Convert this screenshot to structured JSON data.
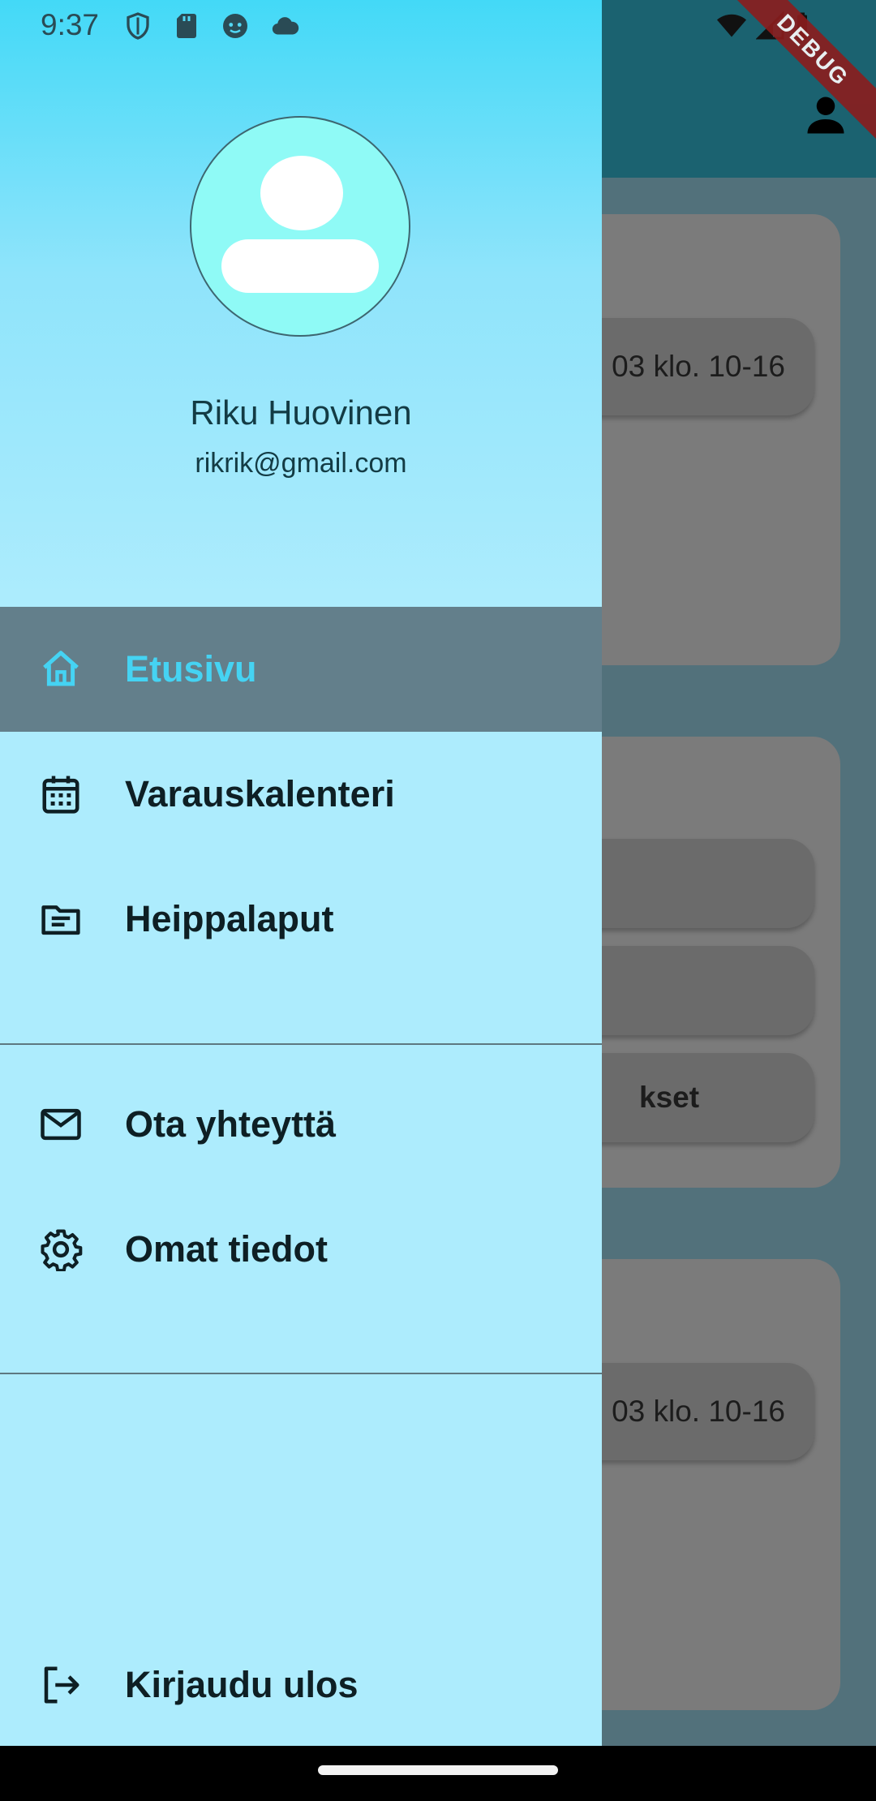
{
  "status_bar": {
    "time": "9:37",
    "left_icons": [
      "shield-icon",
      "sd-card-icon",
      "android-face-icon",
      "cloud-icon"
    ],
    "right_icons": [
      "wifi-icon",
      "signal-icon",
      "battery-icon"
    ]
  },
  "debug_banner": "DEBUG",
  "background_app": {
    "card1_pill": "03 klo. 10-16",
    "card2_pill3": "kset",
    "card3_pill": "03 klo. 10-16"
  },
  "drawer": {
    "user": {
      "name": "Riku Huovinen",
      "email": "rikrik@gmail.com"
    },
    "items": [
      {
        "label": "Etusivu",
        "icon": "home-icon",
        "active": true
      },
      {
        "label": "Varauskalenteri",
        "icon": "calendar-icon",
        "active": false
      },
      {
        "label": "Heippalaput",
        "icon": "notes-icon",
        "active": false
      },
      {
        "label": "Ota yhteyttä",
        "icon": "mail-icon",
        "active": false
      },
      {
        "label": "Omat tiedot",
        "icon": "settings-icon",
        "active": false
      },
      {
        "label": "Kirjaudu ulos",
        "icon": "logout-icon",
        "active": false
      }
    ]
  },
  "colors": {
    "drawer_bg": "#adecfd",
    "active_bg": "#637f8b",
    "active_text": "#45d3f3",
    "app_bar": "#1b6270"
  }
}
